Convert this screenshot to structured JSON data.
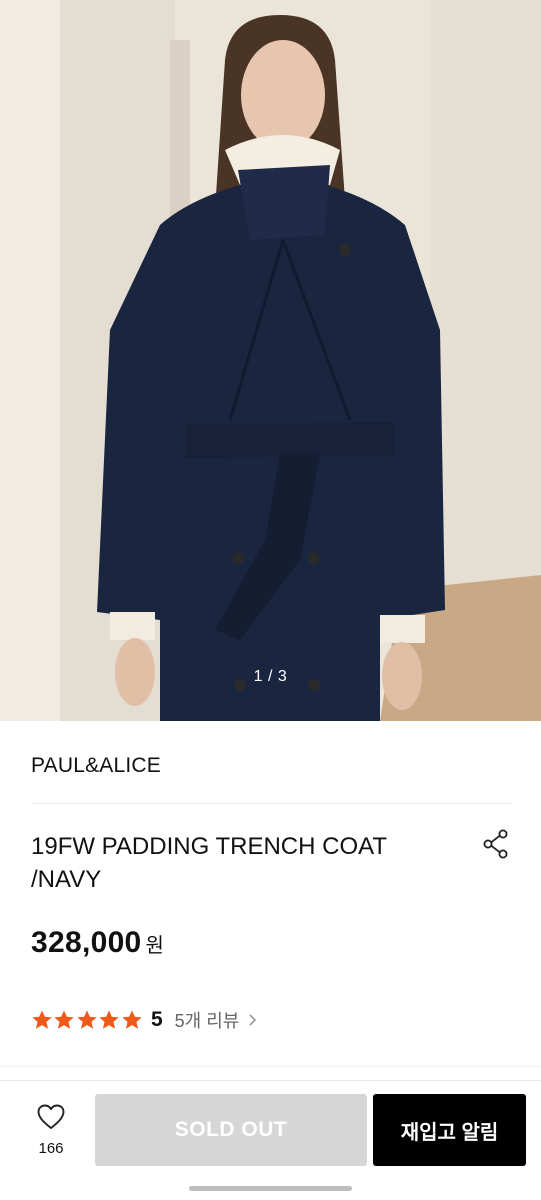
{
  "gallery": {
    "image_alt": "Model wearing navy padding trench coat",
    "counter": "1 / 3"
  },
  "product": {
    "brand": "PAUL&ALICE",
    "name": "19FW PADDING TRENCH COAT /NAVY",
    "price": "328,000",
    "currency": "원",
    "rating": {
      "stars_filled": 5,
      "score": "5",
      "review_count_label": "5개 리뷰"
    }
  },
  "bottom_bar": {
    "like_count": "166",
    "soldout_label": "SOLD OUT",
    "notify_label": "재입고 알림"
  },
  "colors": {
    "star": "#ee5a1c",
    "coat": "#1a2540",
    "soldout_bg": "#d6d6d6",
    "notify_bg": "#000000"
  },
  "icons": {
    "share": "share-icon",
    "like": "heart-icon",
    "review_more": "chevron-right-icon",
    "star": "star-icon"
  }
}
